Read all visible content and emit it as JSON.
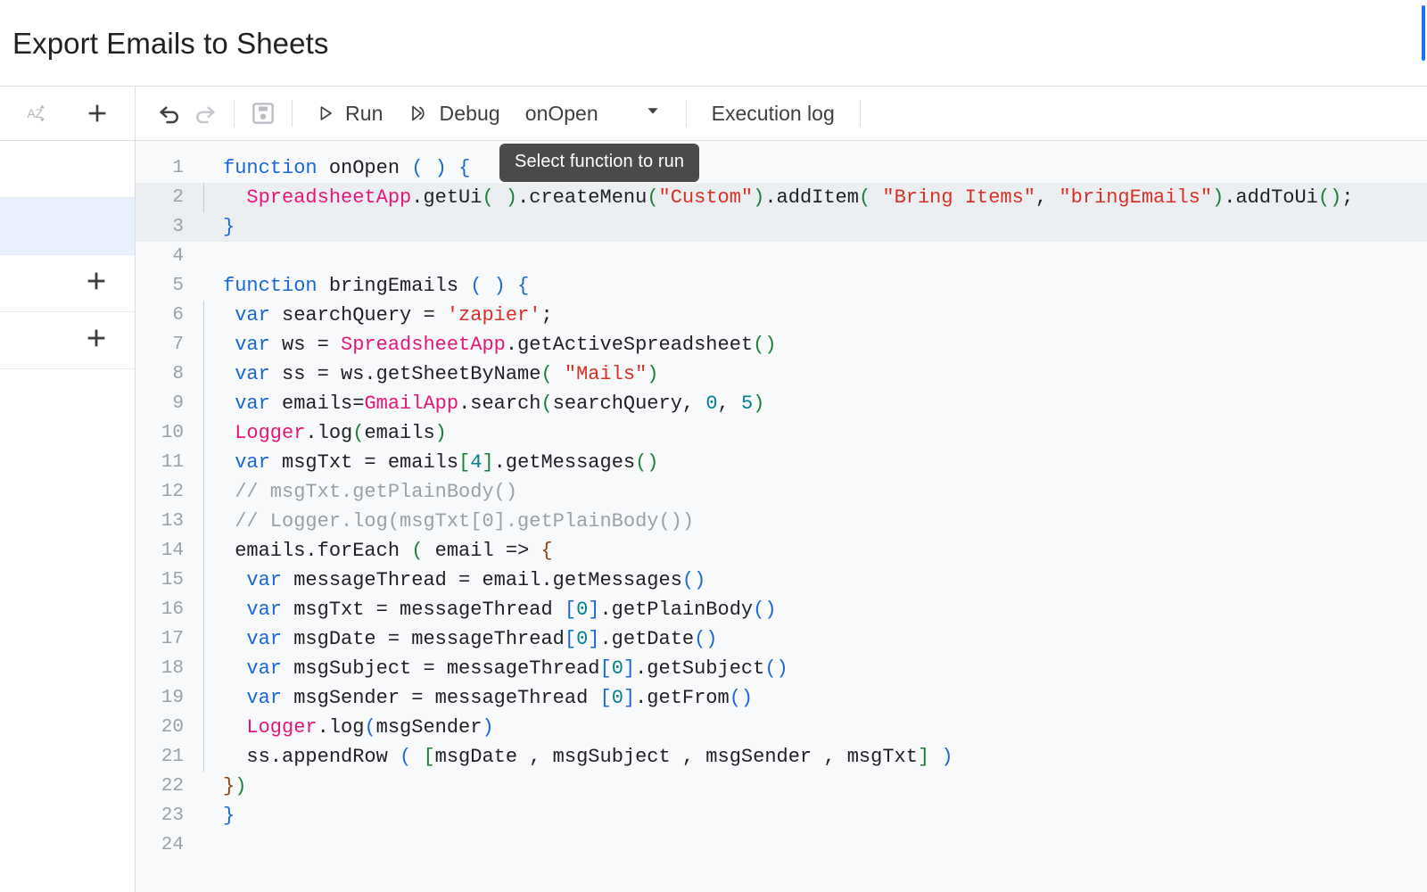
{
  "window": {
    "doc_title": "Export Emails to Sheets",
    "accent_color": "#1a73e8",
    "editor_bg": "#f8f9fa",
    "active_row_color": "#e8f0fe"
  },
  "toolbar": {
    "sort_icon": "sort-az-icon",
    "add_icon": "plus-icon",
    "undo_icon": "undo-icon",
    "redo_icon": "redo-icon",
    "save_icon": "save-icon",
    "run_label": "Run",
    "run_icon": "play-icon",
    "debug_label": "Debug",
    "debug_icon": "debug-icon",
    "function_selected": "onOpen",
    "function_caret_icon": "chevron-down-icon",
    "execution_log_label": "Execution log",
    "tooltip_text": "Select function to run"
  },
  "sidebar": {
    "rows": [
      {
        "id": "row-active",
        "state": "active",
        "icon": ""
      },
      {
        "id": "row-add-1",
        "state": "normal",
        "icon": "plus-icon"
      },
      {
        "id": "row-add-2",
        "state": "normal",
        "icon": "plus-icon"
      }
    ]
  },
  "editor": {
    "language": "javascript",
    "first_visible_line": 1,
    "last_visible_line": 24,
    "highlighted_lines": [
      2,
      3
    ],
    "lines": [
      {
        "n": "1",
        "indent": 0,
        "guide": false
      },
      {
        "n": "2",
        "indent": 1,
        "guide": true
      },
      {
        "n": "3",
        "indent": 0,
        "guide": false
      },
      {
        "n": "4",
        "indent": 0,
        "guide": false
      },
      {
        "n": "5",
        "indent": 0,
        "guide": false
      },
      {
        "n": "6",
        "indent": 1,
        "guide": true
      },
      {
        "n": "7",
        "indent": 1,
        "guide": true
      },
      {
        "n": "8",
        "indent": 1,
        "guide": true
      },
      {
        "n": "9",
        "indent": 1,
        "guide": true
      },
      {
        "n": "10",
        "indent": 1,
        "guide": true
      },
      {
        "n": "11",
        "indent": 1,
        "guide": true
      },
      {
        "n": "12",
        "indent": 1,
        "guide": true
      },
      {
        "n": "13",
        "indent": 1,
        "guide": true
      },
      {
        "n": "14",
        "indent": 1,
        "guide": true
      },
      {
        "n": "15",
        "indent": 1,
        "guide": true
      },
      {
        "n": "16",
        "indent": 1,
        "guide": true
      },
      {
        "n": "17",
        "indent": 1,
        "guide": true
      },
      {
        "n": "18",
        "indent": 1,
        "guide": true
      },
      {
        "n": "19",
        "indent": 1,
        "guide": true
      },
      {
        "n": "20",
        "indent": 1,
        "guide": true
      },
      {
        "n": "21",
        "indent": 1,
        "guide": true
      },
      {
        "n": "22",
        "indent": 0,
        "guide": false
      },
      {
        "n": "23",
        "indent": 0,
        "guide": false
      },
      {
        "n": "24",
        "indent": 0,
        "guide": false
      }
    ],
    "source_text": [
      "function onOpen ( ) {",
      "  SpreadsheetApp.getUi( ).createMenu(\"Custom\").addItem( \"Bring Items\", \"bringEmails\").addToUi();",
      "}",
      "",
      "function bringEmails ( ) {",
      "  var searchQuery = 'zapier';",
      "  var ws = SpreadsheetApp.getActiveSpreadsheet()",
      "  var ss = ws.getSheetByName( \"Mails\")",
      "  var emails=GmailApp.search(searchQuery, 0, 5)",
      "  Logger.log(emails)",
      "  var msgTxt = emails[4].getMessages()",
      "  // msgTxt.getPlainBody()",
      "  // Logger.log(msgTxt[0].getPlainBody())",
      "  emails.forEach ( email => {",
      "    var messageThread = email.getMessages()",
      "    var msgTxt = messageThread [0].getPlainBody()",
      "    var msgDate = messageThread[0].getDate()",
      "    var msgSubject = messageThread[0].getSubject()",
      "    var msgSender = messageThread [0].getFrom()",
      "    Logger.log(msgSender)",
      "    ss.appendRow ( [msgDate , msgSubject , msgSender , msgTxt] )",
      "})",
      "}",
      ""
    ],
    "token_colors": {
      "keyword": "#1967d2",
      "builtin_class": "#e5157b",
      "string": "#d93025",
      "number": "#00838f",
      "comment": "#9aa0a6",
      "paren_green": "#188038",
      "paren_blue": "#1967d2",
      "brace_brown": "#8b4513",
      "plain": "#202124",
      "gutter": "#9aa0a6"
    }
  }
}
